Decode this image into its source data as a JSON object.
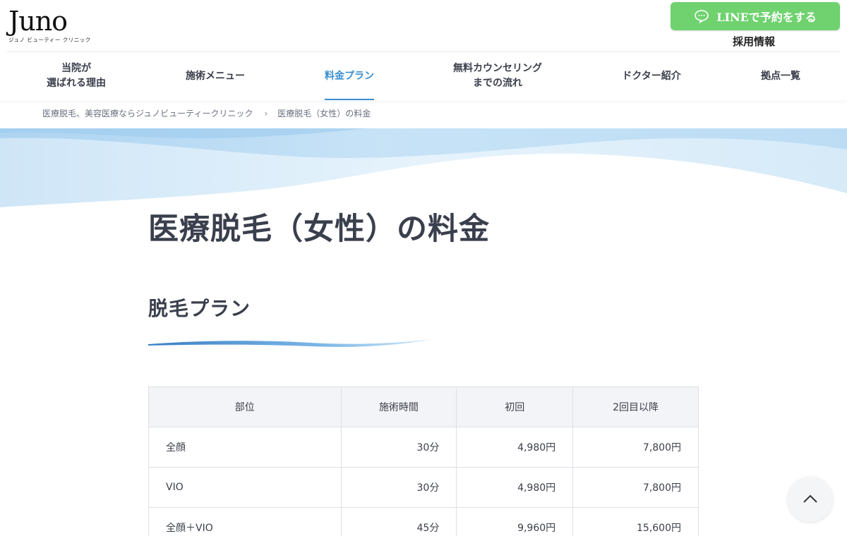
{
  "header": {
    "logo_text": "Juno",
    "logo_subtext": "ジュノ ビューティー クリニック",
    "line_button_label": "LINEで予約をする",
    "recruit_link": "採用情報"
  },
  "nav": {
    "items": [
      {
        "line1": "当院が",
        "line2": "選ばれる理由"
      },
      {
        "line1": "施術メニュー",
        "line2": ""
      },
      {
        "line1": "料金プラン",
        "line2": ""
      },
      {
        "line1": "無料カウンセリング",
        "line2": "までの流れ"
      },
      {
        "line1": "ドクター紹介",
        "line2": ""
      },
      {
        "line1": "拠点一覧",
        "line2": ""
      }
    ],
    "active_index": 2
  },
  "breadcrumb": {
    "home": "医療脱毛、美容医療ならジュノビューティークリニック",
    "separator": "›",
    "current": "医療脱毛（女性）の料金"
  },
  "page": {
    "title": "医療脱毛（女性）の料金",
    "section_title": "脱毛プラン"
  },
  "table": {
    "headers": [
      "部位",
      "施術時間",
      "初回",
      "2回目以降"
    ],
    "rows": [
      [
        "全顔",
        "30分",
        "4,980円",
        "7,800円"
      ],
      [
        "VIO",
        "30分",
        "4,980円",
        "7,800円"
      ],
      [
        "全顔＋VIO",
        "45分",
        "9,960円",
        "15,600円"
      ]
    ]
  },
  "colors": {
    "accent": "#3b8fd0",
    "line_green": "#6fd26f",
    "text": "#3a3f4d",
    "table_header_bg": "#f3f4f7",
    "wave_light": "#e3f1fb",
    "wave_mid": "#bcdcf3"
  },
  "icons": {
    "line": "speech-bubble-icon",
    "to_top": "chevron-up-icon"
  }
}
